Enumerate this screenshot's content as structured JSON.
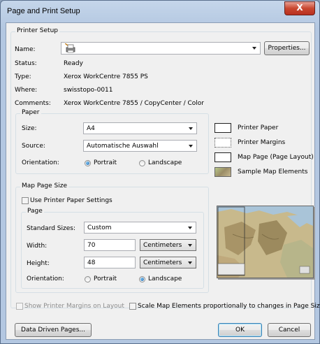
{
  "window": {
    "title": "Page and Print Setup",
    "close_glyph": "X"
  },
  "printer_setup": {
    "group_label": "Printer Setup",
    "name_label": "Name:",
    "name_value": "",
    "properties_button": "Properties...",
    "status_label": "Status:",
    "status_value": "Ready",
    "type_label": "Type:",
    "type_value": "Xerox WorkCentre 7855 PS",
    "where_label": "Where:",
    "where_value": "swisstopo-0011",
    "comments_label": "Comments:",
    "comments_value": "Xerox WorkCentre 7855 / CopyCenter / Color"
  },
  "paper": {
    "group_label": "Paper",
    "size_label": "Size:",
    "size_value": "A4",
    "source_label": "Source:",
    "source_value": "Automatische Auswahl",
    "orientation_label": "Orientation:",
    "portrait_label": "Portrait",
    "landscape_label": "Landscape",
    "selected_orientation": "Portrait"
  },
  "legend": {
    "items": [
      {
        "label": "Printer Paper"
      },
      {
        "label": "Printer Margins"
      },
      {
        "label": "Map Page (Page Layout)"
      },
      {
        "label": "Sample Map Elements"
      }
    ]
  },
  "map_page_size": {
    "group_label": "Map Page Size",
    "use_printer_label": "Use Printer Paper Settings",
    "use_printer_checked": false,
    "page_group_label": "Page",
    "standard_sizes_label": "Standard Sizes:",
    "standard_sizes_value": "Custom",
    "width_label": "Width:",
    "width_value": "70",
    "width_unit": "Centimeters",
    "height_label": "Height:",
    "height_value": "48",
    "height_unit": "Centimeters",
    "orientation_label": "Orientation:",
    "portrait_label": "Portrait",
    "landscape_label": "Landscape",
    "selected_orientation": "Landscape"
  },
  "options": {
    "show_margins_label": "Show Printer Margins on Layout",
    "scale_elements_label": "Scale Map Elements proportionally to changes in Page Size"
  },
  "buttons": {
    "data_driven_pages": "Data Driven Pages...",
    "ok": "OK",
    "cancel": "Cancel"
  }
}
